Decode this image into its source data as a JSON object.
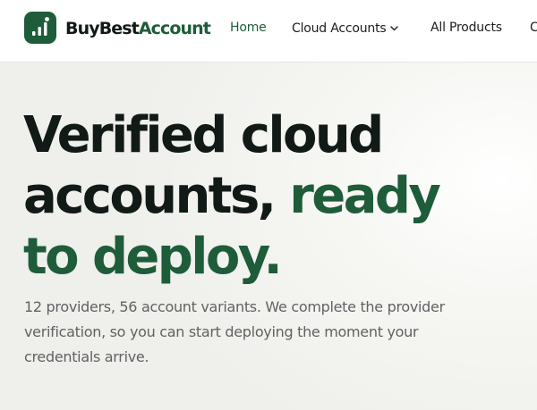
{
  "brand": {
    "name_part1": "BuyBest",
    "name_part2": "Account",
    "logo_icon": "bar-chart-icon",
    "brand_color": "#1e5c3a"
  },
  "nav": {
    "items": [
      {
        "label": "Home",
        "active": true
      },
      {
        "label": "Cloud Accounts",
        "has_dropdown": true,
        "icon": "chevron-down-icon"
      },
      {
        "label": "All Products"
      },
      {
        "label": "C"
      }
    ]
  },
  "hero": {
    "title_line1": "Verified cloud",
    "title_line2_plain": "accounts, ",
    "title_line2_accent": "ready",
    "title_line3_accent": "to deploy.",
    "subtitle": "12 providers, 56 account variants. We complete the provider verification, so you can start deploying the moment your credentials arrive."
  },
  "colors": {
    "text_dark": "#111a16",
    "accent": "#1e5c3a",
    "muted": "#5f6362"
  }
}
